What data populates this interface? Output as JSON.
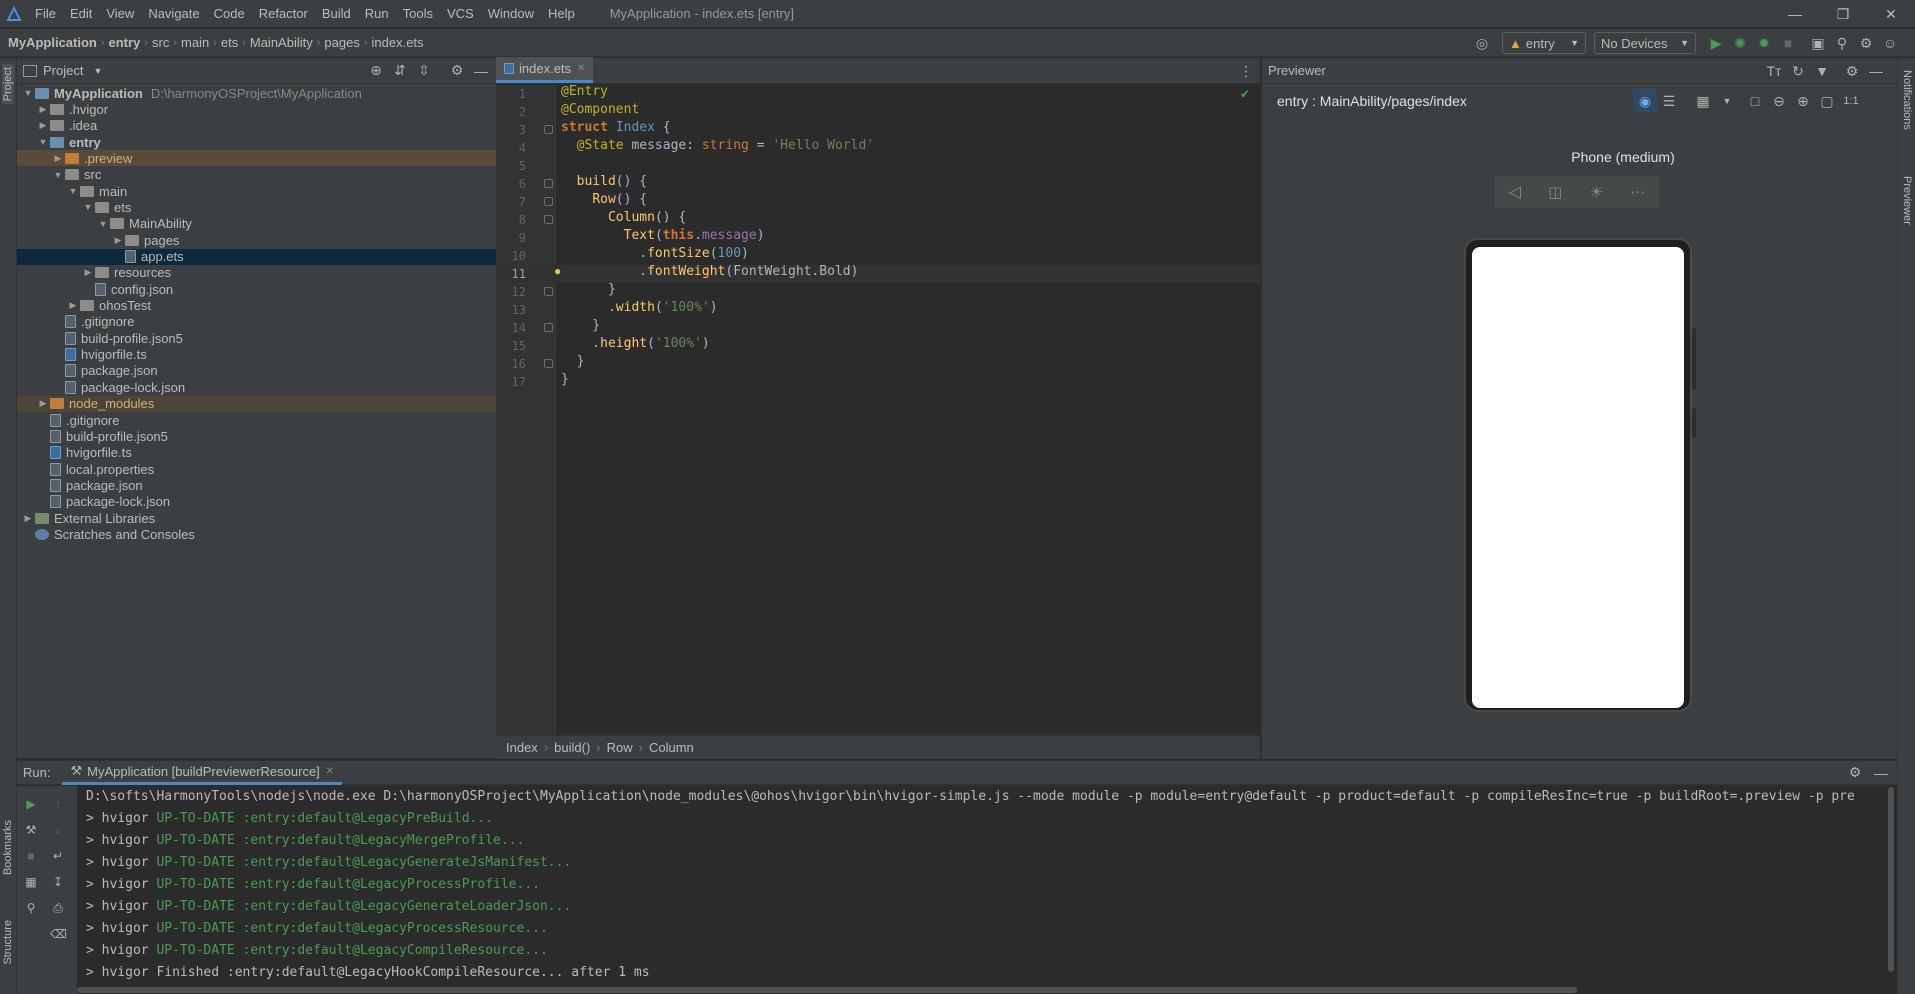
{
  "app": {
    "window_title": "MyApplication - index.ets [entry]",
    "menu": [
      "File",
      "Edit",
      "View",
      "Navigate",
      "Code",
      "Refactor",
      "Build",
      "Run",
      "Tools",
      "VCS",
      "Window",
      "Help"
    ]
  },
  "breadcrumb": [
    "MyApplication",
    "entry",
    "src",
    "main",
    "ets",
    "MainAbility",
    "pages",
    "index.ets"
  ],
  "toolbar": {
    "module_select": "entry",
    "device_select": "No Devices"
  },
  "left_strip": {
    "project_label": "Project",
    "bookmarks_label": "Bookmarks",
    "structure_label": "Structure"
  },
  "right_strip": {
    "notifications_label": "Notifications",
    "previewer_label": "Previewer"
  },
  "project_panel": {
    "title": "Project",
    "tree": [
      {
        "label": "MyApplication",
        "hint": "D:\\harmonyOSProject\\MyApplication",
        "depth": 0,
        "kind": "folder-blue",
        "expanded": true
      },
      {
        "label": ".hvigor",
        "depth": 1,
        "kind": "folder",
        "expanded": false
      },
      {
        "label": ".idea",
        "depth": 1,
        "kind": "folder",
        "expanded": false
      },
      {
        "label": "entry",
        "depth": 1,
        "kind": "folder-blue",
        "expanded": true
      },
      {
        "label": ".preview",
        "depth": 2,
        "kind": "folder-orange",
        "expanded": false
      },
      {
        "label": "src",
        "depth": 2,
        "kind": "folder",
        "expanded": true
      },
      {
        "label": "main",
        "depth": 3,
        "kind": "folder",
        "expanded": true
      },
      {
        "label": "ets",
        "depth": 4,
        "kind": "folder",
        "expanded": true
      },
      {
        "label": "MainAbility",
        "depth": 5,
        "kind": "folder",
        "expanded": true
      },
      {
        "label": "pages",
        "depth": 6,
        "kind": "folder",
        "expanded": false
      },
      {
        "label": "app.ets",
        "depth": 6,
        "kind": "file"
      },
      {
        "label": "resources",
        "depth": 4,
        "kind": "folder",
        "expanded": false
      },
      {
        "label": "config.json",
        "depth": 4,
        "kind": "file"
      },
      {
        "label": "ohosTest",
        "depth": 3,
        "kind": "folder",
        "expanded": false
      },
      {
        "label": ".gitignore",
        "depth": 2,
        "kind": "file"
      },
      {
        "label": "build-profile.json5",
        "depth": 2,
        "kind": "file"
      },
      {
        "label": "hvigorfile.ts",
        "depth": 2,
        "kind": "file-ts"
      },
      {
        "label": "package.json",
        "depth": 2,
        "kind": "file"
      },
      {
        "label": "package-lock.json",
        "depth": 2,
        "kind": "file"
      },
      {
        "label": "node_modules",
        "depth": 1,
        "kind": "folder-orange",
        "expanded": false
      },
      {
        "label": ".gitignore",
        "depth": 1,
        "kind": "file"
      },
      {
        "label": "build-profile.json5",
        "depth": 1,
        "kind": "file"
      },
      {
        "label": "hvigorfile.ts",
        "depth": 1,
        "kind": "file-ts"
      },
      {
        "label": "local.properties",
        "depth": 1,
        "kind": "file"
      },
      {
        "label": "package.json",
        "depth": 1,
        "kind": "file"
      },
      {
        "label": "package-lock.json",
        "depth": 1,
        "kind": "file"
      },
      {
        "label": "External Libraries",
        "depth": 0,
        "kind": "lib",
        "expanded": false
      },
      {
        "label": "Scratches and Consoles",
        "depth": 0,
        "kind": "scratch"
      }
    ]
  },
  "editor": {
    "tab": "index.ets",
    "current_line": 11,
    "lines": [
      "@Entry",
      "@Component",
      "struct Index {",
      "  @State message: string = 'Hello World'",
      "",
      "  build() {",
      "    Row() {",
      "      Column() {",
      "        Text(this.message)",
      "          .fontSize(100)",
      "          .fontWeight(FontWeight.Bold)",
      "      }",
      "      .width('100%')",
      "    }",
      "    .height('100%')",
      "  }",
      "}"
    ],
    "breadcrumb": [
      "Index",
      "build()",
      "Row",
      "Column"
    ]
  },
  "previewer": {
    "title": "Previewer",
    "path": "entry : MainAbility/pages/index",
    "device": "Phone (medium)"
  },
  "run_panel": {
    "label": "Run:",
    "tab": "MyApplication [buildPreviewerResource]",
    "command": "D:\\softs\\HarmonyTools\\nodejs\\node.exe D:\\harmonyOSProject\\MyApplication\\node_modules\\@ohos\\hvigor\\bin\\hvigor-simple.js --mode module -p module=entry@default -p product=default -p compileResInc=true -p buildRoot=.preview -p pre",
    "lines": [
      {
        "prefix": "> hvigor ",
        "status": "UP-TO-DATE",
        "task": ":entry:default@LegacyPreBuild..."
      },
      {
        "prefix": "> hvigor ",
        "status": "UP-TO-DATE",
        "task": ":entry:default@LegacyMergeProfile..."
      },
      {
        "prefix": "> hvigor ",
        "status": "UP-TO-DATE",
        "task": ":entry:default@LegacyGenerateJsManifest..."
      },
      {
        "prefix": "> hvigor ",
        "status": "UP-TO-DATE",
        "task": ":entry:default@LegacyProcessProfile..."
      },
      {
        "prefix": "> hvigor ",
        "status": "UP-TO-DATE",
        "task": ":entry:default@LegacyGenerateLoaderJson..."
      },
      {
        "prefix": "> hvigor ",
        "status": "UP-TO-DATE",
        "task": ":entry:default@LegacyProcessResource..."
      },
      {
        "prefix": "> hvigor ",
        "status": "UP-TO-DATE",
        "task": ":entry:default@LegacyCompileResource..."
      },
      {
        "prefix": "> hvigor ",
        "status": "Finished",
        "task": ":entry:default@LegacyHookCompileResource... after 1 ms"
      }
    ]
  }
}
